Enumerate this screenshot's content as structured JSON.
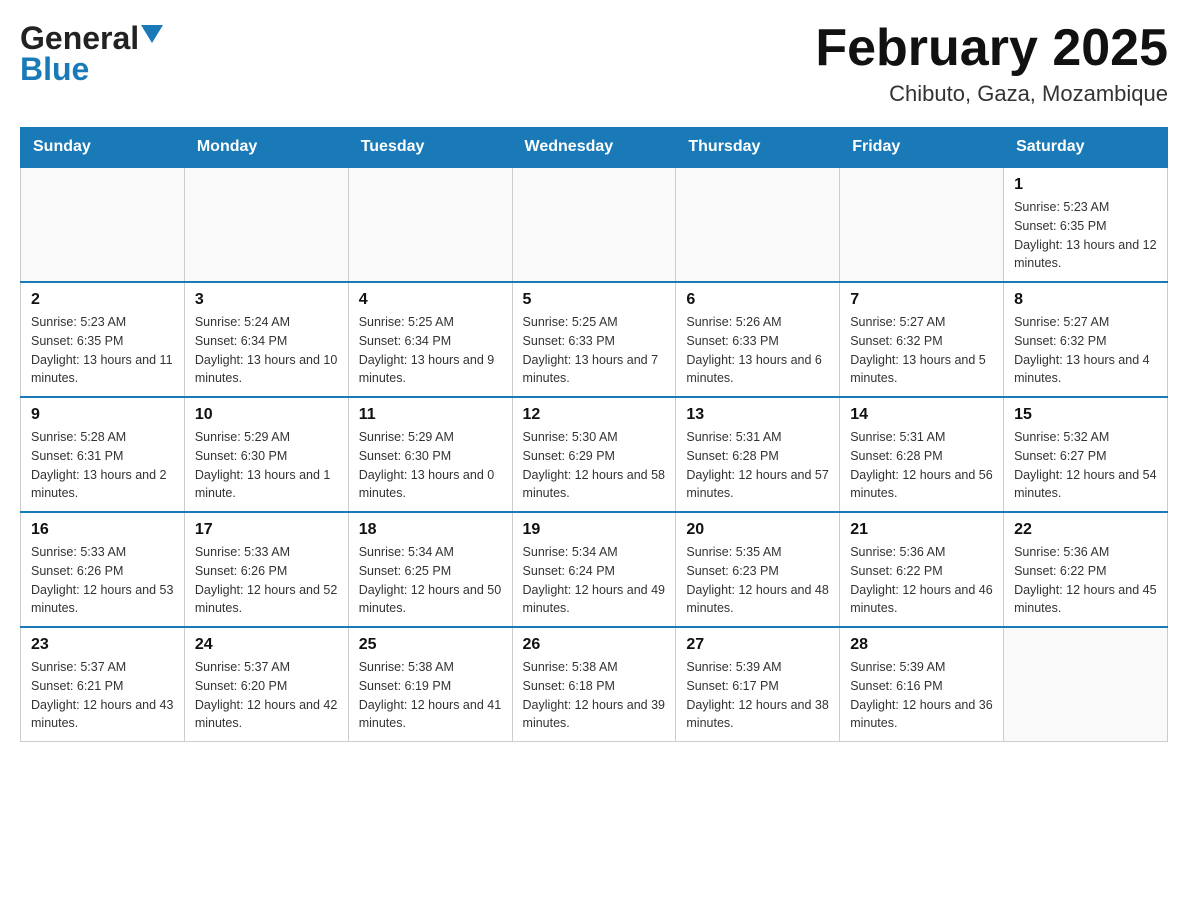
{
  "header": {
    "logo_general": "General",
    "logo_blue": "Blue",
    "month_title": "February 2025",
    "location": "Chibuto, Gaza, Mozambique"
  },
  "weekdays": [
    "Sunday",
    "Monday",
    "Tuesday",
    "Wednesday",
    "Thursday",
    "Friday",
    "Saturday"
  ],
  "weeks": [
    [
      {
        "day": "",
        "info": ""
      },
      {
        "day": "",
        "info": ""
      },
      {
        "day": "",
        "info": ""
      },
      {
        "day": "",
        "info": ""
      },
      {
        "day": "",
        "info": ""
      },
      {
        "day": "",
        "info": ""
      },
      {
        "day": "1",
        "info": "Sunrise: 5:23 AM\nSunset: 6:35 PM\nDaylight: 13 hours and 12 minutes."
      }
    ],
    [
      {
        "day": "2",
        "info": "Sunrise: 5:23 AM\nSunset: 6:35 PM\nDaylight: 13 hours and 11 minutes."
      },
      {
        "day": "3",
        "info": "Sunrise: 5:24 AM\nSunset: 6:34 PM\nDaylight: 13 hours and 10 minutes."
      },
      {
        "day": "4",
        "info": "Sunrise: 5:25 AM\nSunset: 6:34 PM\nDaylight: 13 hours and 9 minutes."
      },
      {
        "day": "5",
        "info": "Sunrise: 5:25 AM\nSunset: 6:33 PM\nDaylight: 13 hours and 7 minutes."
      },
      {
        "day": "6",
        "info": "Sunrise: 5:26 AM\nSunset: 6:33 PM\nDaylight: 13 hours and 6 minutes."
      },
      {
        "day": "7",
        "info": "Sunrise: 5:27 AM\nSunset: 6:32 PM\nDaylight: 13 hours and 5 minutes."
      },
      {
        "day": "8",
        "info": "Sunrise: 5:27 AM\nSunset: 6:32 PM\nDaylight: 13 hours and 4 minutes."
      }
    ],
    [
      {
        "day": "9",
        "info": "Sunrise: 5:28 AM\nSunset: 6:31 PM\nDaylight: 13 hours and 2 minutes."
      },
      {
        "day": "10",
        "info": "Sunrise: 5:29 AM\nSunset: 6:30 PM\nDaylight: 13 hours and 1 minute."
      },
      {
        "day": "11",
        "info": "Sunrise: 5:29 AM\nSunset: 6:30 PM\nDaylight: 13 hours and 0 minutes."
      },
      {
        "day": "12",
        "info": "Sunrise: 5:30 AM\nSunset: 6:29 PM\nDaylight: 12 hours and 58 minutes."
      },
      {
        "day": "13",
        "info": "Sunrise: 5:31 AM\nSunset: 6:28 PM\nDaylight: 12 hours and 57 minutes."
      },
      {
        "day": "14",
        "info": "Sunrise: 5:31 AM\nSunset: 6:28 PM\nDaylight: 12 hours and 56 minutes."
      },
      {
        "day": "15",
        "info": "Sunrise: 5:32 AM\nSunset: 6:27 PM\nDaylight: 12 hours and 54 minutes."
      }
    ],
    [
      {
        "day": "16",
        "info": "Sunrise: 5:33 AM\nSunset: 6:26 PM\nDaylight: 12 hours and 53 minutes."
      },
      {
        "day": "17",
        "info": "Sunrise: 5:33 AM\nSunset: 6:26 PM\nDaylight: 12 hours and 52 minutes."
      },
      {
        "day": "18",
        "info": "Sunrise: 5:34 AM\nSunset: 6:25 PM\nDaylight: 12 hours and 50 minutes."
      },
      {
        "day": "19",
        "info": "Sunrise: 5:34 AM\nSunset: 6:24 PM\nDaylight: 12 hours and 49 minutes."
      },
      {
        "day": "20",
        "info": "Sunrise: 5:35 AM\nSunset: 6:23 PM\nDaylight: 12 hours and 48 minutes."
      },
      {
        "day": "21",
        "info": "Sunrise: 5:36 AM\nSunset: 6:22 PM\nDaylight: 12 hours and 46 minutes."
      },
      {
        "day": "22",
        "info": "Sunrise: 5:36 AM\nSunset: 6:22 PM\nDaylight: 12 hours and 45 minutes."
      }
    ],
    [
      {
        "day": "23",
        "info": "Sunrise: 5:37 AM\nSunset: 6:21 PM\nDaylight: 12 hours and 43 minutes."
      },
      {
        "day": "24",
        "info": "Sunrise: 5:37 AM\nSunset: 6:20 PM\nDaylight: 12 hours and 42 minutes."
      },
      {
        "day": "25",
        "info": "Sunrise: 5:38 AM\nSunset: 6:19 PM\nDaylight: 12 hours and 41 minutes."
      },
      {
        "day": "26",
        "info": "Sunrise: 5:38 AM\nSunset: 6:18 PM\nDaylight: 12 hours and 39 minutes."
      },
      {
        "day": "27",
        "info": "Sunrise: 5:39 AM\nSunset: 6:17 PM\nDaylight: 12 hours and 38 minutes."
      },
      {
        "day": "28",
        "info": "Sunrise: 5:39 AM\nSunset: 6:16 PM\nDaylight: 12 hours and 36 minutes."
      },
      {
        "day": "",
        "info": ""
      }
    ]
  ]
}
